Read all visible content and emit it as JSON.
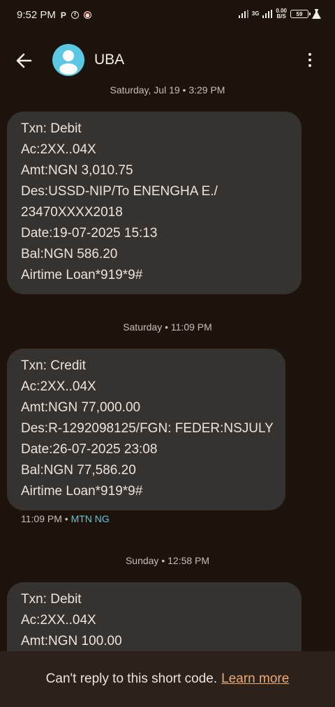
{
  "status_bar": {
    "time": "9:52 PM",
    "icons": [
      "parking-p-icon",
      "facebook-icon",
      "alarm-icon"
    ],
    "network_label": "3G",
    "speed_value": "0.00",
    "speed_unit": "B/S",
    "battery": "59"
  },
  "app_bar": {
    "contact_name": "UBA"
  },
  "thread": {
    "sep1": "Saturday, Jul 19 • 3:29 PM",
    "msg1": [
      "Txn: Debit",
      "Ac:2XX..04X",
      "Amt:NGN 3,010.75",
      "Des:USSD-NIP/To ENENGHA E./",
      "23470XXXX2018",
      "Date:19-07-2025 15:13",
      "Bal:NGN 586.20",
      "Airtime Loan*919*9#"
    ],
    "sep2": "Saturday • 11:09 PM",
    "msg2": [
      "Txn: Credit",
      "Ac:2XX..04X",
      "Amt:NGN 77,000.00",
      "Des:R-1292098125/FGN: FEDER:NSJULY",
      "Date:26-07-2025 23:08",
      "Bal:NGN 77,586.20",
      "Airtime Loan*919*9#"
    ],
    "msg2_time": "11:09 PM",
    "msg2_dot": "•",
    "msg2_sim": "MTN NG",
    "sep3": "Sunday • 12:58 PM",
    "msg3": [
      "Txn: Debit",
      "Ac:2XX..04X",
      "Amt:NGN 100.00"
    ]
  },
  "footer": {
    "text": "Can't reply to this short code.",
    "link": "Learn more"
  },
  "colors": {
    "background": "#1c140c",
    "bubble": "#353230",
    "avatar": "#5ac8e2",
    "link": "#f0a872",
    "sim_label": "#5ac8e2"
  }
}
